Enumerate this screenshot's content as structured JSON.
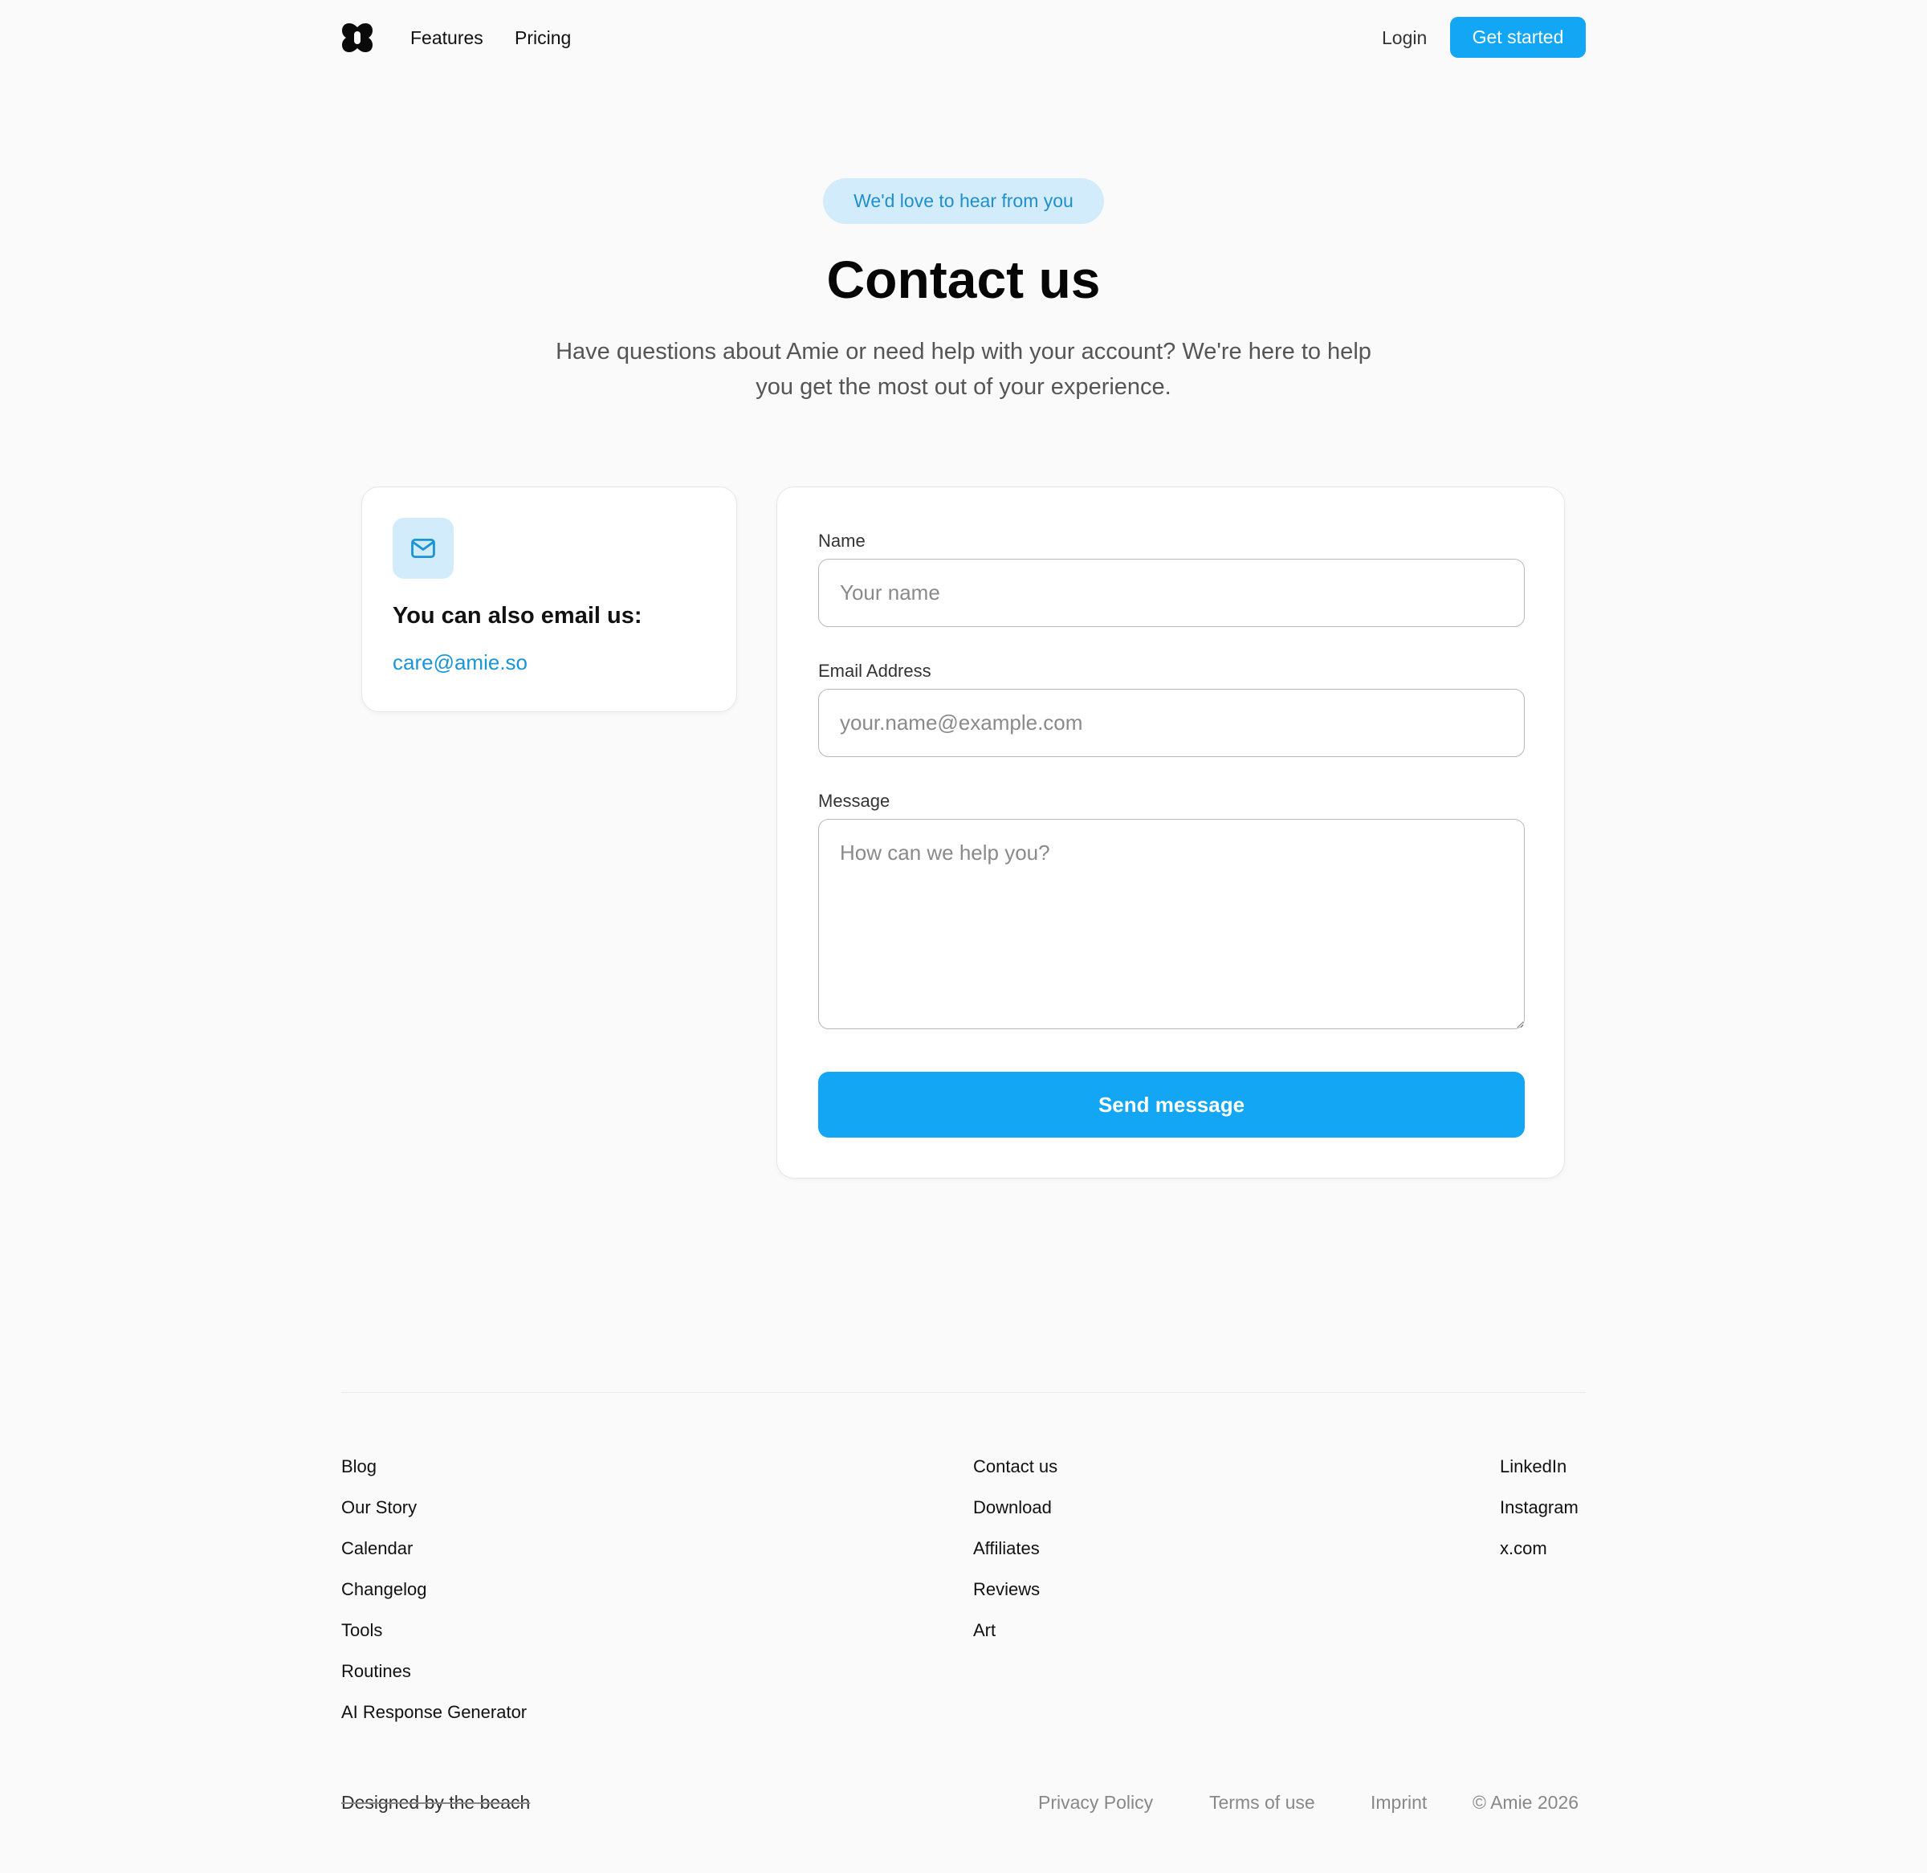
{
  "nav": {
    "logo_icon": "amie-logo-icon",
    "features": "Features",
    "pricing": "Pricing",
    "login": "Login",
    "get_started": "Get started"
  },
  "hero": {
    "pill": "We'd love to hear from you",
    "title": "Contact us",
    "subtitle": "Have questions about Amie or need help with your account? We're here to help you get the most out of your experience."
  },
  "email_card": {
    "icon": "mail-icon",
    "heading": "You can also email us:",
    "email": "care@amie.so"
  },
  "form": {
    "name_label": "Name",
    "name_placeholder": "Your name",
    "email_label": "Email Address",
    "email_placeholder": "your.name@example.com",
    "message_label": "Message",
    "message_placeholder": "How can we help you?",
    "submit": "Send message"
  },
  "footer": {
    "col1": [
      "Blog",
      "Our Story",
      "Calendar",
      "Changelog",
      "Tools",
      "Routines",
      "AI Response Generator"
    ],
    "col2": [
      "Contact us",
      "Download",
      "Affiliates",
      "Reviews",
      "Art"
    ],
    "col3": [
      "LinkedIn",
      "Instagram",
      "x.com"
    ],
    "designed": "Designed by the beach",
    "privacy": "Privacy Policy",
    "terms": "Terms of use",
    "imprint": "Imprint",
    "copyright": "© Amie 2026"
  },
  "colors": {
    "accent": "#12a6f5",
    "accent_light": "#d3ecfb",
    "link": "#1b95d6",
    "background": "#fafafa"
  }
}
